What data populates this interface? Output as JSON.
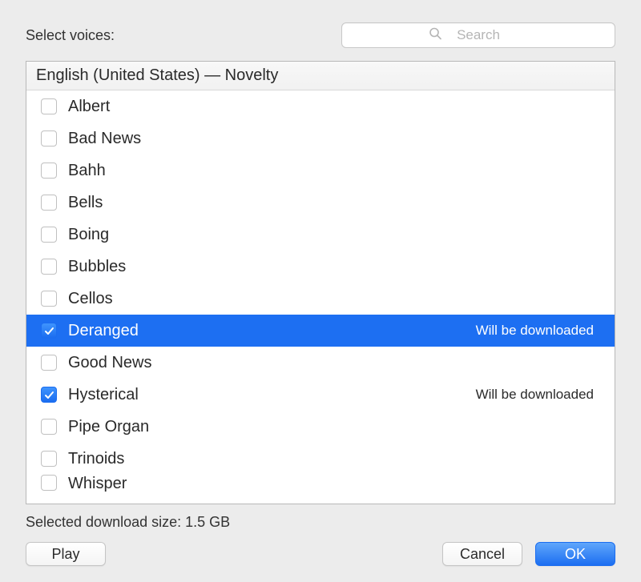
{
  "header": {
    "label": "Select voices:",
    "search_placeholder": "Search"
  },
  "group_header": "English (United States) — Novelty",
  "voices": [
    {
      "label": "Albert",
      "checked": false,
      "selected": false,
      "status": ""
    },
    {
      "label": "Bad News",
      "checked": false,
      "selected": false,
      "status": ""
    },
    {
      "label": "Bahh",
      "checked": false,
      "selected": false,
      "status": ""
    },
    {
      "label": "Bells",
      "checked": false,
      "selected": false,
      "status": ""
    },
    {
      "label": "Boing",
      "checked": false,
      "selected": false,
      "status": ""
    },
    {
      "label": "Bubbles",
      "checked": false,
      "selected": false,
      "status": ""
    },
    {
      "label": "Cellos",
      "checked": false,
      "selected": false,
      "status": ""
    },
    {
      "label": "Deranged",
      "checked": true,
      "selected": true,
      "status": "Will be downloaded"
    },
    {
      "label": "Good News",
      "checked": false,
      "selected": false,
      "status": ""
    },
    {
      "label": "Hysterical",
      "checked": true,
      "selected": false,
      "status": "Will be downloaded"
    },
    {
      "label": "Pipe Organ",
      "checked": false,
      "selected": false,
      "status": ""
    },
    {
      "label": "Trinoids",
      "checked": false,
      "selected": false,
      "status": ""
    },
    {
      "label": "Whisper",
      "checked": false,
      "selected": false,
      "status": "",
      "partial": true
    }
  ],
  "status_line": "Selected download size: 1.5 GB",
  "buttons": {
    "play": "Play",
    "cancel": "Cancel",
    "ok": "OK"
  }
}
